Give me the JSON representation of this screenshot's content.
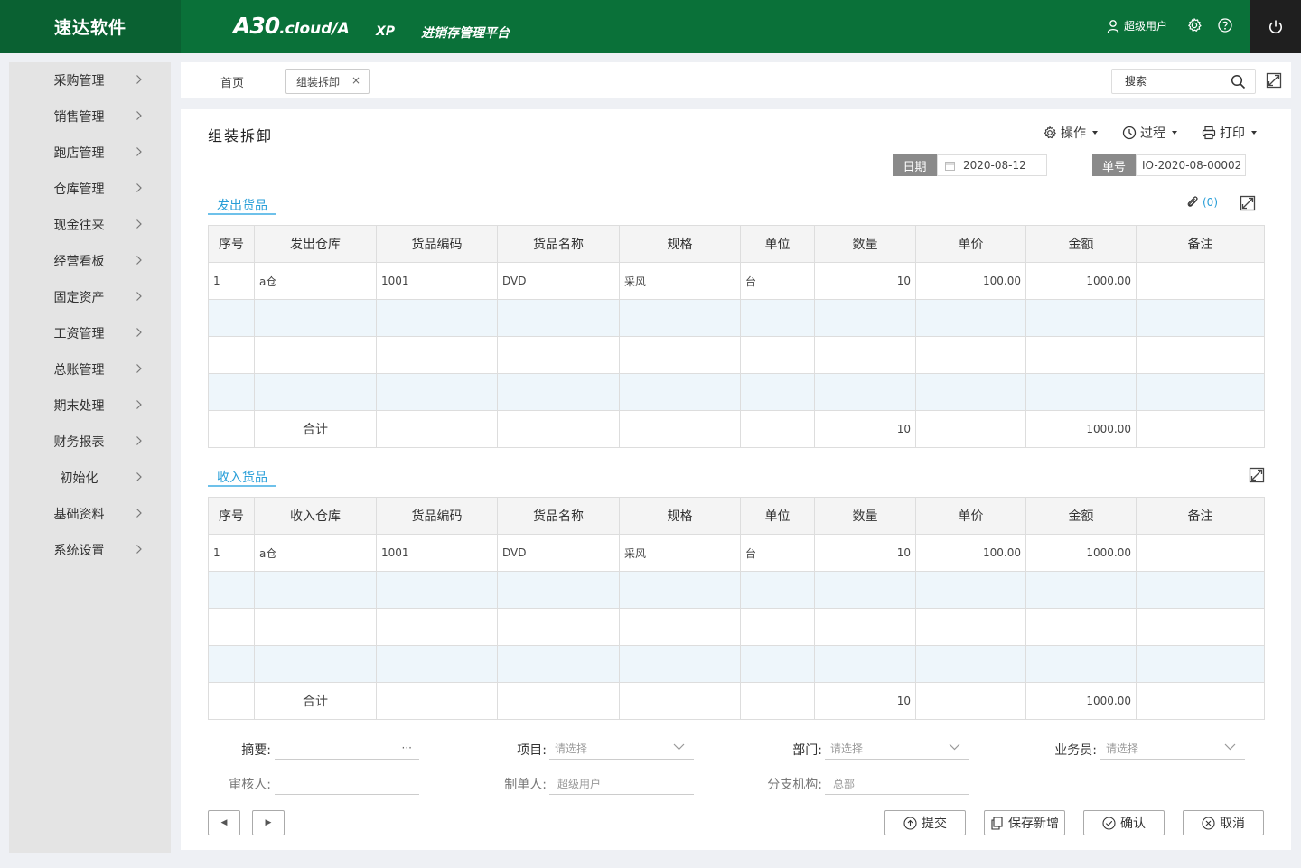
{
  "header": {
    "brand": "速达软件",
    "logo_main": "A30",
    "logo_suffix": ".cloud/A",
    "edition": "XP",
    "platform": "进销存管理平台",
    "user": "超级用户"
  },
  "sidebar": {
    "items": [
      {
        "label": "采购管理"
      },
      {
        "label": "销售管理"
      },
      {
        "label": "跑店管理"
      },
      {
        "label": "仓库管理"
      },
      {
        "label": "现金往来"
      },
      {
        "label": "经营看板"
      },
      {
        "label": "固定资产"
      },
      {
        "label": "工资管理"
      },
      {
        "label": "总账管理"
      },
      {
        "label": "期末处理"
      },
      {
        "label": "财务报表"
      },
      {
        "label": "初始化"
      },
      {
        "label": "基础资料"
      },
      {
        "label": "系统设置"
      }
    ]
  },
  "tabs": {
    "home": "首页",
    "active": "组装拆卸",
    "close": "×"
  },
  "search": {
    "placeholder": "搜索"
  },
  "page": {
    "title": "组装拆卸",
    "toolbar": {
      "operate": "操作",
      "process": "过程",
      "print": "打印"
    },
    "date_label": "日期",
    "date_value": "2020-08-12",
    "no_label": "单号",
    "no_value": "IO-2020-08-00002",
    "attachment_count": "(0)"
  },
  "out_section": {
    "title": "发出货品",
    "columns": [
      "序号",
      "发出仓库",
      "货品编码",
      "货品名称",
      "规格",
      "单位",
      "数量",
      "单价",
      "金额",
      "备注"
    ],
    "rows": [
      [
        "1",
        "a仓",
        "1001",
        "DVD",
        "采风",
        "台",
        "10",
        "100.00",
        "1000.00",
        ""
      ],
      [
        "",
        "",
        "",
        "",
        "",
        "",
        "",
        "",
        "",
        ""
      ],
      [
        "",
        "",
        "",
        "",
        "",
        "",
        "",
        "",
        "",
        ""
      ],
      [
        "",
        "",
        "",
        "",
        "",
        "",
        "",
        "",
        "",
        ""
      ]
    ],
    "total": {
      "label": "合计",
      "qty": "10",
      "amount": "1000.00"
    }
  },
  "in_section": {
    "title": "收入货品",
    "columns": [
      "序号",
      "收入仓库",
      "货品编码",
      "货品名称",
      "规格",
      "单位",
      "数量",
      "单价",
      "金额",
      "备注"
    ],
    "rows": [
      [
        "1",
        "a仓",
        "1001",
        "DVD",
        "采风",
        "台",
        "10",
        "100.00",
        "1000.00",
        ""
      ],
      [
        "",
        "",
        "",
        "",
        "",
        "",
        "",
        "",
        "",
        ""
      ],
      [
        "",
        "",
        "",
        "",
        "",
        "",
        "",
        "",
        "",
        ""
      ],
      [
        "",
        "",
        "",
        "",
        "",
        "",
        "",
        "",
        "",
        ""
      ]
    ],
    "total": {
      "label": "合计",
      "qty": "10",
      "amount": "1000.00"
    }
  },
  "footer": {
    "summary_label": "摘要:",
    "summary_dots": "···",
    "project_label": "项目:",
    "project_placeholder": "请选择",
    "dept_label": "部门:",
    "dept_placeholder": "请选择",
    "salesman_label": "业务员:",
    "salesman_placeholder": "请选择",
    "reviewer_label": "审核人:",
    "maker_label": "制单人:",
    "maker_value": "超级用户",
    "branch_label": "分支机构:",
    "branch_value": "总部"
  },
  "buttons": {
    "prev": "◀",
    "next": "▶",
    "submit": "提交",
    "save_new": "保存新增",
    "confirm": "确认",
    "cancel": "取消"
  },
  "colors": {
    "header_green": "#0a7139",
    "brand_green": "#0a6132",
    "accent_blue": "#2a9fd8",
    "alt_row": "#eef6fb"
  }
}
